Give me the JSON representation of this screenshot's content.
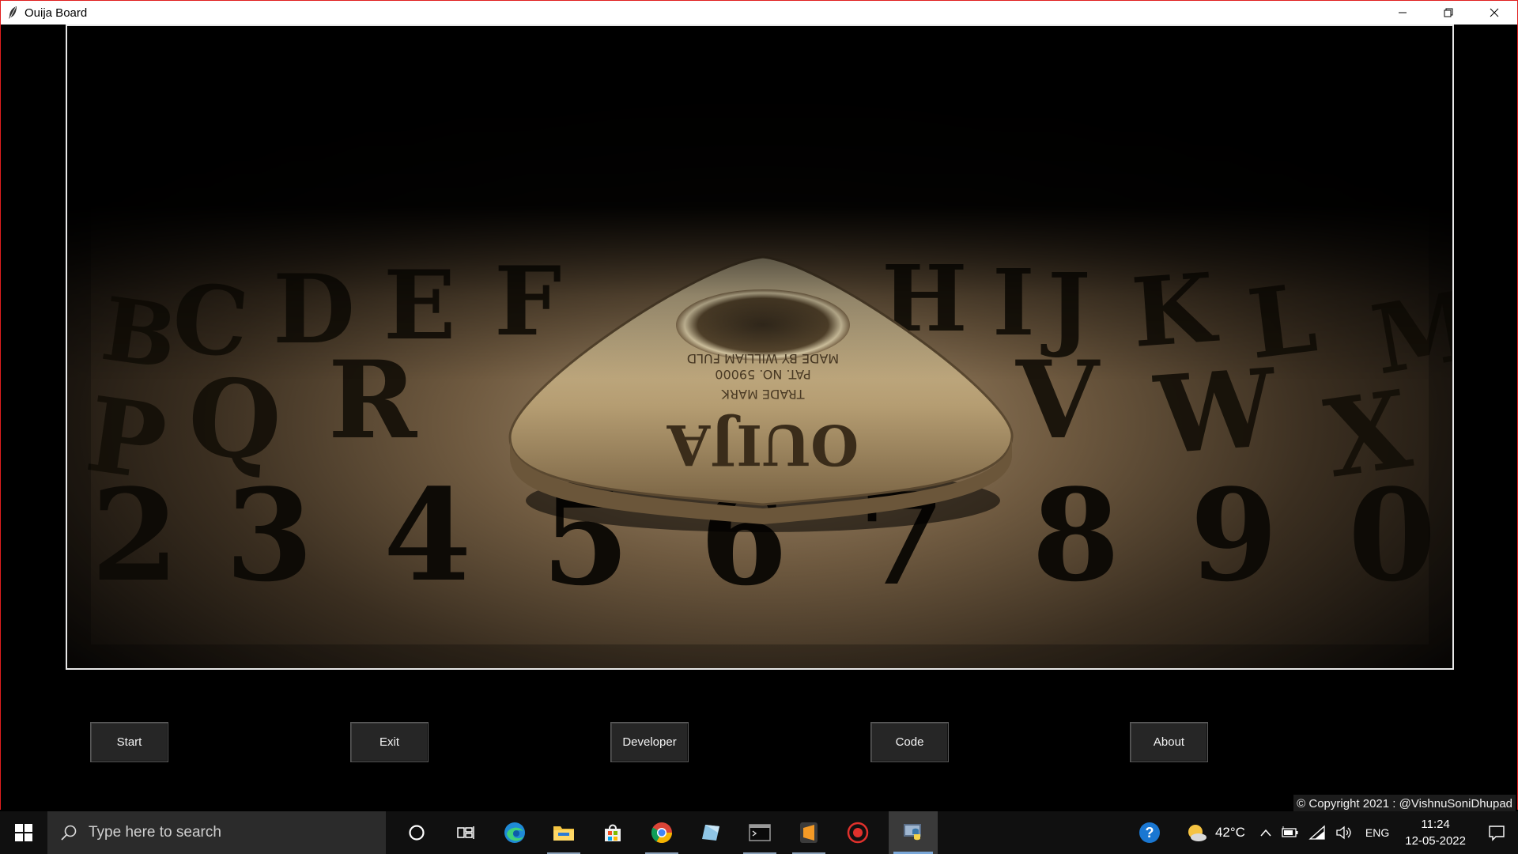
{
  "window": {
    "title": "Ouija Board",
    "icon": "feather-icon",
    "controls": [
      "minimize-icon",
      "restore-icon",
      "close-icon"
    ]
  },
  "buttons": {
    "start": "Start",
    "exit": "Exit",
    "developer": "Developer",
    "code": "Code",
    "about": "About"
  },
  "copyright": "© Copyright 2021 : @VishnuSoniDhupad",
  "taskbar": {
    "search_placeholder": "Type here to search",
    "apps": [
      "cortana-icon",
      "task-view-icon",
      "edge-icon",
      "file-explorer-icon",
      "store-icon",
      "chrome-icon",
      "tablet-app-icon",
      "terminal-icon",
      "sublime-text-icon",
      "recorder-icon",
      "python-app-icon"
    ],
    "tray": {
      "help_icon": "help-icon",
      "weather_icon": "weather-sun-cloud-icon",
      "temperature": "42°C",
      "language": "ENG",
      "time": "11:24",
      "date": "12-05-2022"
    }
  },
  "colors": {
    "window_border": "#e01e1e",
    "button_bg": "#262626",
    "taskbar_bg": "#101010",
    "search_bg": "#2b2b2b"
  }
}
